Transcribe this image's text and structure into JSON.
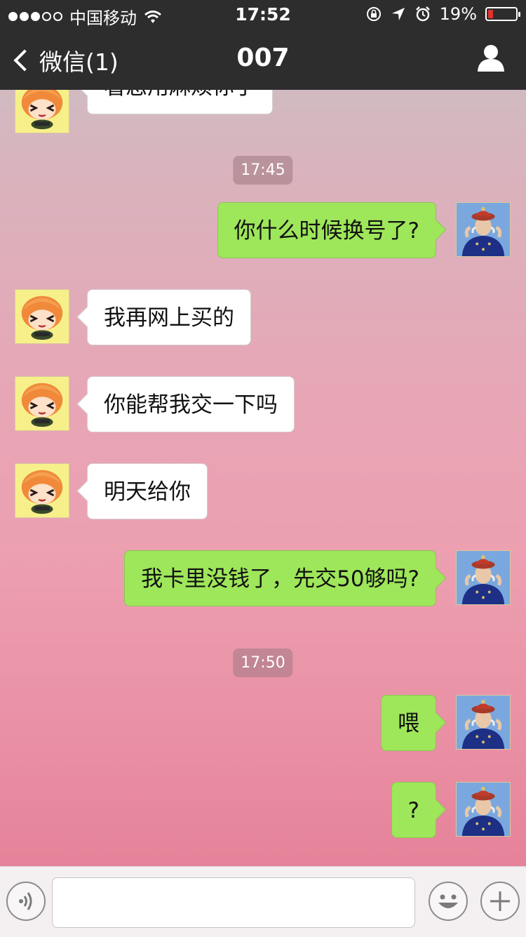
{
  "status_bar": {
    "carrier": "中国移动",
    "time": "17:52",
    "battery": "19%",
    "battery_level": 0.19,
    "signal_bars_filled": 3,
    "signal_bars_total": 5
  },
  "nav": {
    "back_label": "微信(1)",
    "title": "007"
  },
  "colors": {
    "outgoing_bubble": "#9ee65a",
    "incoming_bubble": "#ffffff",
    "nav_background": "#262628",
    "battery_low": "#e3312e"
  },
  "messages": {
    "partial_top": "看您用麻烦你了",
    "ts1": "17:45",
    "m1": "你什么时候换号了?",
    "m2": "我再网上买的",
    "m3": "你能帮我交一下吗",
    "m4": "明天给你",
    "m5": "我卡里没钱了，先交50够吗?",
    "ts2": "17:50",
    "m6": "喂",
    "m7": "?"
  },
  "input": {
    "value": ""
  },
  "icons": {
    "voice": "voice-input-icon",
    "emoji": "emoji-icon",
    "plus": "plus-icon",
    "profile": "user-profile-icon"
  }
}
